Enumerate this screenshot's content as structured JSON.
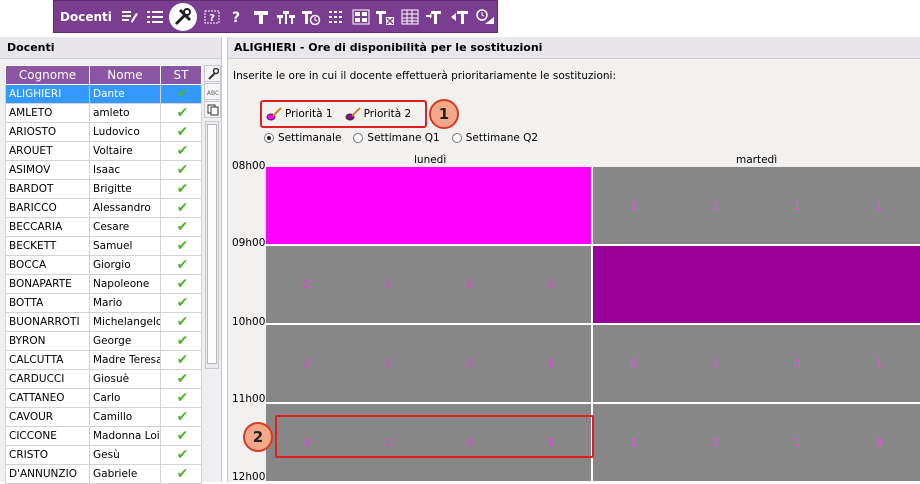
{
  "toolbar": {
    "title": "Docenti",
    "icons": [
      "edit-list-icon",
      "list-icon",
      "tools-icon",
      "help-key-icon",
      "question-icon",
      "teacher-icon",
      "group-icon",
      "teacher-clock-icon",
      "grid-icon",
      "timetable-icon",
      "teacher-remove-icon",
      "table-icon",
      "teacher-move-icon",
      "teacher-arrow-icon",
      "clock-teacher-icon"
    ]
  },
  "left": {
    "title": "Docenti",
    "columns": {
      "surname": "Cognome",
      "name": "Nome",
      "st": "ST"
    },
    "teachers": [
      {
        "surname": "ALIGHIERI",
        "name": "Dante",
        "selected": true
      },
      {
        "surname": "AMLETO",
        "name": "amleto"
      },
      {
        "surname": "ARIOSTO",
        "name": "Ludovico"
      },
      {
        "surname": "AROUET",
        "name": "Voltaire"
      },
      {
        "surname": "ASIMOV",
        "name": "Isaac"
      },
      {
        "surname": "BARDOT",
        "name": "Brigitte"
      },
      {
        "surname": "BARICCO",
        "name": "Alessandro"
      },
      {
        "surname": "BECCARIA",
        "name": "Cesare"
      },
      {
        "surname": "BECKETT",
        "name": "Samuel"
      },
      {
        "surname": "BOCCA",
        "name": "Giorgio"
      },
      {
        "surname": "BONAPARTE",
        "name": "Napoleone"
      },
      {
        "surname": "BOTTA",
        "name": "Mario"
      },
      {
        "surname": "BUONARROTI",
        "name": "Michelangelo"
      },
      {
        "surname": "BYRON",
        "name": "George"
      },
      {
        "surname": "CALCUTTA",
        "name": "Madre Teresa"
      },
      {
        "surname": "CARDUCCI",
        "name": "Giosuè"
      },
      {
        "surname": "CATTANEO",
        "name": "Carlo"
      },
      {
        "surname": "CAVOUR",
        "name": "Camillo"
      },
      {
        "surname": "CICCONE",
        "name": "Madonna Loiu"
      },
      {
        "surname": "CRISTO",
        "name": "Gesù"
      },
      {
        "surname": "D'ANNUNZIO",
        "name": "Gabriele"
      }
    ],
    "side_tools": [
      "wrench-icon",
      "abc-icon",
      "copy-icon"
    ]
  },
  "right": {
    "title": "ALIGHIERI - Ore di disponibilità per le sostituzioni",
    "instructions": "Inserite le ore in cui il docente effettuerà prioritariamente le sostituzioni:",
    "priority1": "Priorità 1",
    "priority2": "Priorità 2",
    "radios": [
      {
        "label": "Settimanale",
        "checked": true
      },
      {
        "label": "Settimane Q1",
        "checked": false
      },
      {
        "label": "Settimane Q2",
        "checked": false
      }
    ],
    "days": [
      "lunedì",
      "martedì"
    ],
    "hours": [
      "08h00",
      "09h00",
      "10h00",
      "11h00",
      "12h00"
    ],
    "callouts": [
      "1",
      "2"
    ],
    "colors": {
      "priority1": "#ff00ff",
      "priority2": "#990099",
      "normal": "#878787"
    },
    "slots": [
      [
        {
          "type": "priority1",
          "values": []
        },
        {
          "type": "normal",
          "values": [
            "1",
            "1",
            "1",
            "1"
          ]
        }
      ],
      [
        {
          "type": "normal",
          "values": [
            "2",
            "3",
            "2",
            "3"
          ]
        },
        {
          "type": "priority2",
          "values": []
        }
      ],
      [
        {
          "type": "normal",
          "values": [
            "2",
            "1",
            "2",
            "1"
          ]
        },
        {
          "type": "normal",
          "values": [
            "0",
            "1",
            "0",
            "1"
          ]
        }
      ],
      [
        {
          "type": "normal",
          "values": [
            "3",
            "1",
            "3",
            "1"
          ]
        },
        {
          "type": "normal",
          "values": [
            "1",
            "3",
            "1",
            "3"
          ]
        }
      ]
    ]
  }
}
